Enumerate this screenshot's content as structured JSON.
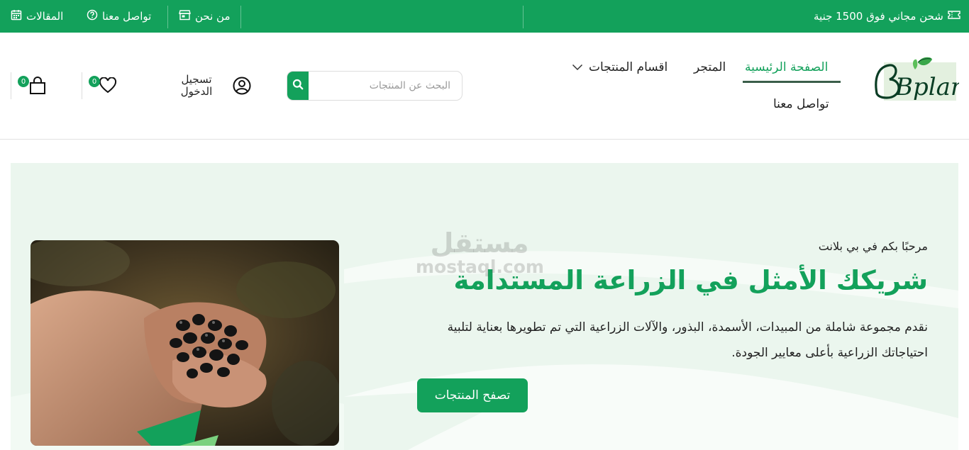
{
  "topbar": {
    "articles": "المقالات",
    "contact": "تواصل معنا",
    "about": "من نحن",
    "shipping": "شحن مجاني فوق 1500 جنية"
  },
  "logo": {
    "text": "Bplant"
  },
  "nav": {
    "home": "الصفحة الرئيسية",
    "shop": "المتجر",
    "categories": "اقسام المنتجات",
    "contact": "تواصل معنا"
  },
  "search": {
    "placeholder": "البحث عن المنتجات"
  },
  "account": {
    "login": "تسجيل الدخول"
  },
  "wishlist": {
    "count": "0"
  },
  "cart": {
    "count": "0"
  },
  "hero": {
    "welcome": "مرحبًا بكم في بي بلانت",
    "headline": "شريكك الأمثل في الزراعة المستدامة",
    "description": "نقدم مجموعة شاملة من المبيدات، الأسمدة، البذور، والآلات الزراعية التي تم تطويرها بعناية لتلبية احتياجاتك الزراعية بأعلى معايير الجودة.",
    "cta": "تصفح المنتجات"
  },
  "watermark": {
    "arabic": "مستقل",
    "latin": "mostaql.com"
  },
  "colors": {
    "accent": "#13a15b",
    "hero_bg": "#ebf6ee",
    "nav_underline": "#3b5e4a"
  }
}
